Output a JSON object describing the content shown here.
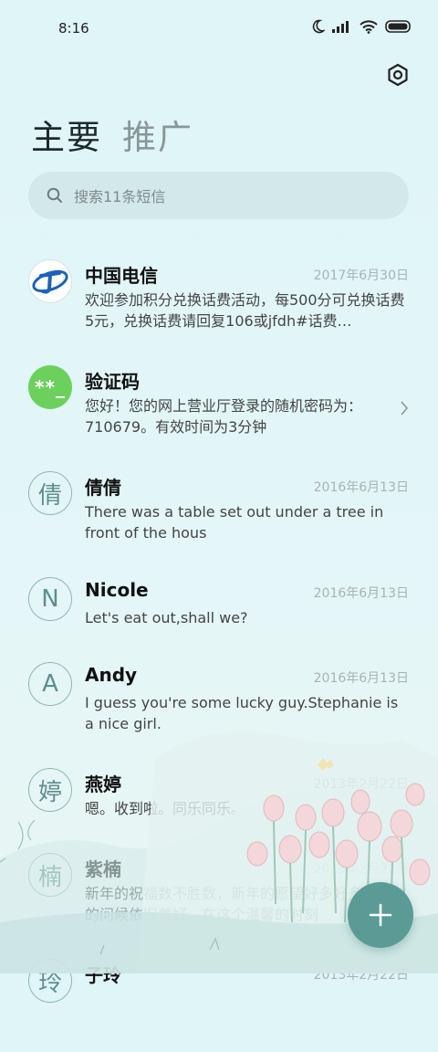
{
  "status_bar": {
    "time": "8:16",
    "icons": [
      "moon-icon",
      "signal-icon",
      "wifi-icon",
      "battery-icon"
    ]
  },
  "header": {
    "settings_icon": "gear-icon",
    "tabs": [
      {
        "label": "主要",
        "active": true
      },
      {
        "label": "推广",
        "active": false
      }
    ]
  },
  "search": {
    "placeholder": "搜索11条短信",
    "icon": "search-icon"
  },
  "conversations": [
    {
      "name": "中国电信",
      "avatar": "china-telecom-logo",
      "date": "2017年6月30日",
      "preview": "欢迎参加积分兑换话费活动，每500分可兑换话费5元，兑换话费请回复106或jfdh#话费…"
    },
    {
      "name": "验证码",
      "avatar_text": "**_",
      "date": "",
      "preview": "您好！您的网上营业厅登录的随机密码为：710679。有效时间为3分钟"
    },
    {
      "name": "倩倩",
      "avatar_text": "倩",
      "date": "2016年6月13日",
      "preview": "There was a table set out under a tree in front of the hous"
    },
    {
      "name": "Nicole",
      "avatar_text": "N",
      "date": "2016年6月13日",
      "preview": "Let's eat out,shall we?"
    },
    {
      "name": "Andy",
      "avatar_text": "A",
      "date": "2016年6月13日",
      "preview": "I guess you're some lucky guy.Stephanie is a nice girl."
    },
    {
      "name": "燕婷",
      "avatar_text": "婷",
      "date": "2013年2月22日",
      "preview": "嗯。收到啦。同乐同乐。"
    },
    {
      "name": "紫楠",
      "avatar_text": "楠",
      "date": "2013年2月22日",
      "preview": "新年的祝福数不胜数，新年的愿望好多好多，新年的问候依旧美好，在这个温馨的时刻"
    },
    {
      "name": "子玲",
      "avatar_text": "玲",
      "date": "2013年2月22日",
      "preview": ""
    }
  ],
  "fab": {
    "icon": "plus-icon"
  }
}
